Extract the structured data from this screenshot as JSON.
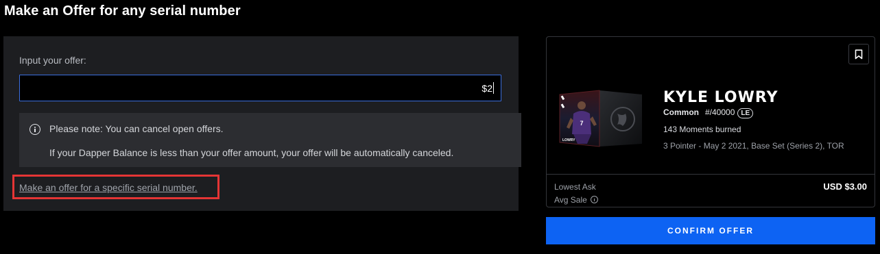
{
  "page": {
    "title": "Make an Offer for any serial number"
  },
  "offer_form": {
    "label": "Input your offer:",
    "input_value": "$2",
    "note_line1": "Please note: You can cancel open offers.",
    "note_line2": "If your Dapper Balance is less than your offer amount, your offer will be automatically canceled.",
    "specific_serial_link": "Make an offer for a specific serial number."
  },
  "moment": {
    "player_name": "KYLE LOWRY",
    "tier": "Common",
    "serial": "#/40000",
    "badge": "LE",
    "burned": "143 Moments burned",
    "play_info": "3 Pointer - May 2 2021, Base Set (Series 2), TOR",
    "lowest_ask_label": "Lowest Ask",
    "avg_sale_label": "Avg Sale",
    "lowest_ask_value": "USD $3.00",
    "card_jersey_number": "7",
    "card_player_tag": "LOWRY"
  },
  "actions": {
    "confirm_label": "CONFIRM OFFER"
  },
  "colors": {
    "accent_blue": "#0d63f3",
    "input_border": "#3b6fe0",
    "highlight_red": "#e53535",
    "panel_bg": "#1d1e21",
    "note_bg": "#2c2d31"
  },
  "icons": {
    "note": "info-icon",
    "bookmark": "bookmark-icon",
    "avg_sale": "info-icon"
  }
}
